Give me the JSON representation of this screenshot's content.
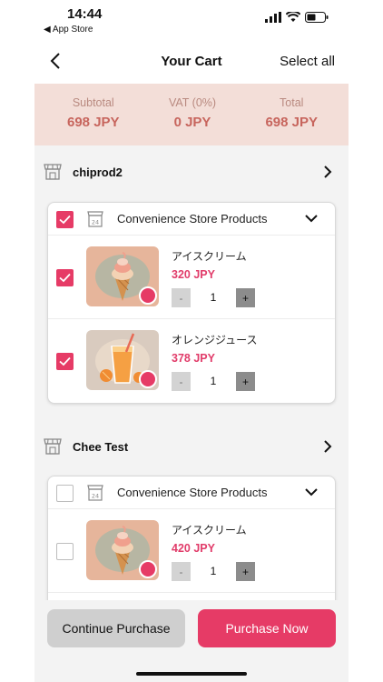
{
  "status_bar": {
    "time": "14:44",
    "back_app": "◀ App Store"
  },
  "nav": {
    "title": "Your Cart",
    "select_all": "Select all"
  },
  "summary": {
    "subtotal_label": "Subtotal",
    "subtotal_value": "698 JPY",
    "vat_label": "VAT (0%)",
    "vat_value": "0 JPY",
    "total_label": "Total",
    "total_value": "698 JPY"
  },
  "stores": [
    {
      "name": "chiprod2",
      "category": "Convenience Store Products",
      "category_checked": true,
      "items": [
        {
          "name": "アイスクリーム",
          "price": "320 JPY",
          "qty": "1",
          "checked": true,
          "minus": "-",
          "plus": "+"
        },
        {
          "name": "オレンジジュース",
          "price": "378 JPY",
          "qty": "1",
          "checked": true,
          "minus": "-",
          "plus": "+"
        }
      ]
    },
    {
      "name": "Chee Test",
      "category": "Convenience Store Products",
      "category_checked": false,
      "items": [
        {
          "name": "アイスクリーム",
          "price": "420 JPY",
          "qty": "1",
          "checked": false,
          "minus": "-",
          "plus": "+"
        }
      ]
    }
  ],
  "bottom": {
    "continue_label": "Continue Purchase",
    "buy_label": "Purchase Now"
  },
  "colors": {
    "accent": "#e63b66",
    "summary_bg": "#f3ded8",
    "summary_text": "#c7655d"
  }
}
